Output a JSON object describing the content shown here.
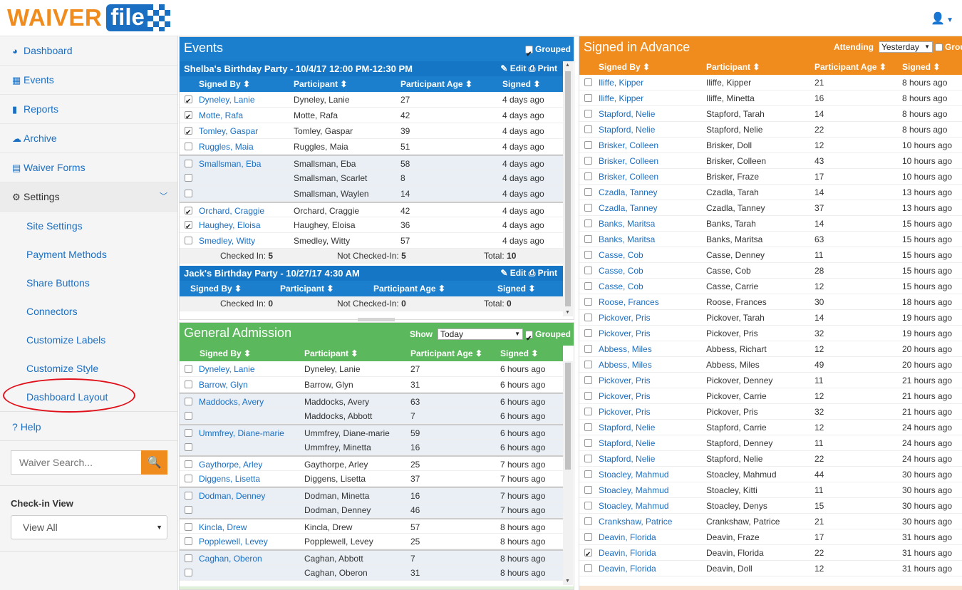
{
  "brand": {
    "waiver": "WAIVER",
    "file": "file"
  },
  "sidebar": {
    "nav": [
      {
        "icon": "◕",
        "label": "Dashboard"
      },
      {
        "icon": "▦",
        "label": "Events"
      },
      {
        "icon": "▮",
        "label": "Reports"
      },
      {
        "icon": "☁",
        "label": "Archive"
      },
      {
        "icon": "▤",
        "label": "Waiver Forms"
      }
    ],
    "settings": {
      "icon": "⚙",
      "label": "Settings"
    },
    "sub": [
      "Site Settings",
      "Payment Methods",
      "Share Buttons",
      "Connectors",
      "Customize Labels",
      "Customize Style",
      "Dashboard Layout"
    ],
    "help": {
      "icon": "?",
      "label": "Help"
    },
    "search_placeholder": "Waiver Search...",
    "checkin_label": "Check-in View",
    "checkin_value": "View All"
  },
  "events": {
    "title": "Events",
    "grouped_label": "Grouped",
    "columns": [
      "Signed By ⬍",
      "Participant ⬍",
      "Participant Age ⬍",
      "Signed ⬍"
    ],
    "groups": [
      {
        "title": "Shelba's Birthday Party - 10/4/17 12:00 PM-12:30 PM",
        "edit": "✎ Edit",
        "print": "⎙ Print",
        "rows": [
          {
            "checked": true,
            "signed_by": "Dyneley, Lanie",
            "participant": "Dyneley, Lanie",
            "age": "27",
            "signed": "4 days ago",
            "shade": false,
            "sep": false
          },
          {
            "checked": true,
            "signed_by": "Motte, Rafa",
            "participant": "Motte, Rafa",
            "age": "42",
            "signed": "4 days ago",
            "shade": false,
            "sep": false
          },
          {
            "checked": true,
            "signed_by": "Tomley, Gaspar",
            "participant": "Tomley, Gaspar",
            "age": "39",
            "signed": "4 days ago",
            "shade": false,
            "sep": false
          },
          {
            "checked": false,
            "signed_by": "Ruggles, Maia",
            "participant": "Ruggles, Maia",
            "age": "51",
            "signed": "4 days ago",
            "shade": false,
            "sep": false
          },
          {
            "checked": false,
            "signed_by": "Smallsman, Eba",
            "participant": "Smallsman, Eba",
            "age": "58",
            "signed": "4 days ago",
            "shade": true,
            "sep": true
          },
          {
            "checked": false,
            "signed_by": "",
            "participant": "Smallsman, Scarlet",
            "age": "8",
            "signed": "4 days ago",
            "shade": true,
            "sep": false
          },
          {
            "checked": false,
            "signed_by": "",
            "participant": "Smallsman, Waylen",
            "age": "14",
            "signed": "4 days ago",
            "shade": true,
            "sep": false
          },
          {
            "checked": true,
            "signed_by": "Orchard, Craggie",
            "participant": "Orchard, Craggie",
            "age": "42",
            "signed": "4 days ago",
            "shade": false,
            "sep": true
          },
          {
            "checked": true,
            "signed_by": "Haughey, Eloisa",
            "participant": "Haughey, Eloisa",
            "age": "36",
            "signed": "4 days ago",
            "shade": false,
            "sep": false
          },
          {
            "checked": false,
            "signed_by": "Smedley, Witty",
            "participant": "Smedley, Witty",
            "age": "57",
            "signed": "4 days ago",
            "shade": false,
            "sep": false
          }
        ],
        "totals": {
          "checked_label": "Checked In:",
          "checked": "5",
          "not_label": "Not Checked-In:",
          "not": "5",
          "total_label": "Total:",
          "total": "10"
        }
      },
      {
        "title": "Jack's Birthday Party - 10/27/17 4:30 AM",
        "edit": "✎ Edit",
        "print": "⎙ Print",
        "rows": [],
        "totals": {
          "checked_label": "Checked In:",
          "checked": "0",
          "not_label": "Not Checked-In:",
          "not": "0",
          "total_label": "Total:",
          "total": "0"
        }
      }
    ]
  },
  "general": {
    "title": "General Admission",
    "show_label": "Show",
    "show_value": "Today",
    "grouped_label": "Grouped",
    "columns": [
      "Signed By ⬍",
      "Participant ⬍",
      "Participant Age ⬍",
      "Signed ⬍"
    ],
    "rows": [
      {
        "checked": false,
        "signed_by": "Dyneley, Lanie",
        "participant": "Dyneley, Lanie",
        "age": "27",
        "signed": "6 hours ago",
        "shade": false,
        "sep": false
      },
      {
        "checked": false,
        "signed_by": "Barrow, Glyn",
        "participant": "Barrow, Glyn",
        "age": "31",
        "signed": "6 hours ago",
        "shade": false,
        "sep": false
      },
      {
        "checked": false,
        "signed_by": "Maddocks, Avery",
        "participant": "Maddocks, Avery",
        "age": "63",
        "signed": "6 hours ago",
        "shade": true,
        "sep": true
      },
      {
        "checked": false,
        "signed_by": "",
        "participant": "Maddocks, Abbott",
        "age": "7",
        "signed": "6 hours ago",
        "shade": true,
        "sep": false
      },
      {
        "checked": false,
        "signed_by": "Ummfrey, Diane-marie",
        "participant": "Ummfrey, Diane-marie",
        "age": "59",
        "signed": "6 hours ago",
        "shade": true,
        "sep": true
      },
      {
        "checked": false,
        "signed_by": "",
        "participant": "Ummfrey, Minetta",
        "age": "16",
        "signed": "6 hours ago",
        "shade": true,
        "sep": false
      },
      {
        "checked": false,
        "signed_by": "Gaythorpe, Arley",
        "participant": "Gaythorpe, Arley",
        "age": "25",
        "signed": "7 hours ago",
        "shade": false,
        "sep": true
      },
      {
        "checked": false,
        "signed_by": "Diggens, Lisetta",
        "participant": "Diggens, Lisetta",
        "age": "37",
        "signed": "7 hours ago",
        "shade": false,
        "sep": false
      },
      {
        "checked": false,
        "signed_by": "Dodman, Denney",
        "participant": "Dodman, Minetta",
        "age": "16",
        "signed": "7 hours ago",
        "shade": true,
        "sep": true
      },
      {
        "checked": false,
        "signed_by": "",
        "participant": "Dodman, Denney",
        "age": "46",
        "signed": "7 hours ago",
        "shade": true,
        "sep": false
      },
      {
        "checked": false,
        "signed_by": "Kincla, Drew",
        "participant": "Kincla, Drew",
        "age": "57",
        "signed": "8 hours ago",
        "shade": false,
        "sep": true
      },
      {
        "checked": false,
        "signed_by": "Popplewell, Levey",
        "participant": "Popplewell, Levey",
        "age": "25",
        "signed": "8 hours ago",
        "shade": false,
        "sep": false
      },
      {
        "checked": false,
        "signed_by": "Caghan, Oberon",
        "participant": "Caghan, Abbott",
        "age": "7",
        "signed": "8 hours ago",
        "shade": true,
        "sep": true
      },
      {
        "checked": false,
        "signed_by": "",
        "participant": "Caghan, Oberon",
        "age": "31",
        "signed": "8 hours ago",
        "shade": true,
        "sep": false
      }
    ]
  },
  "advance": {
    "title": "Signed in Advance",
    "attending_label": "Attending",
    "attending_value": "Yesterday",
    "grouped_label": "Group",
    "columns": [
      "Signed By ⬍",
      "Participant ⬍",
      "Participant Age ⬍",
      "Signed ⬍"
    ],
    "rows": [
      {
        "checked": false,
        "signed_by": "Iliffe, Kipper",
        "participant": "Iliffe, Kipper",
        "age": "21",
        "signed": "8 hours ago"
      },
      {
        "checked": false,
        "signed_by": "Iliffe, Kipper",
        "participant": "Iliffe, Minetta",
        "age": "16",
        "signed": "8 hours ago"
      },
      {
        "checked": false,
        "signed_by": "Stapford, Nelie",
        "participant": "Stapford, Tarah",
        "age": "14",
        "signed": "8 hours ago"
      },
      {
        "checked": false,
        "signed_by": "Stapford, Nelie",
        "participant": "Stapford, Nelie",
        "age": "22",
        "signed": "8 hours ago"
      },
      {
        "checked": false,
        "signed_by": "Brisker, Colleen",
        "participant": "Brisker, Doll",
        "age": "12",
        "signed": "10 hours ago"
      },
      {
        "checked": false,
        "signed_by": "Brisker, Colleen",
        "participant": "Brisker, Colleen",
        "age": "43",
        "signed": "10 hours ago"
      },
      {
        "checked": false,
        "signed_by": "Brisker, Colleen",
        "participant": "Brisker, Fraze",
        "age": "17",
        "signed": "10 hours ago"
      },
      {
        "checked": false,
        "signed_by": "Czadla, Tanney",
        "participant": "Czadla, Tarah",
        "age": "14",
        "signed": "13 hours ago"
      },
      {
        "checked": false,
        "signed_by": "Czadla, Tanney",
        "participant": "Czadla, Tanney",
        "age": "37",
        "signed": "13 hours ago"
      },
      {
        "checked": false,
        "signed_by": "Banks, Maritsa",
        "participant": "Banks, Tarah",
        "age": "14",
        "signed": "15 hours ago"
      },
      {
        "checked": false,
        "signed_by": "Banks, Maritsa",
        "participant": "Banks, Maritsa",
        "age": "63",
        "signed": "15 hours ago"
      },
      {
        "checked": false,
        "signed_by": "Casse, Cob",
        "participant": "Casse, Denney",
        "age": "11",
        "signed": "15 hours ago"
      },
      {
        "checked": false,
        "signed_by": "Casse, Cob",
        "participant": "Casse, Cob",
        "age": "28",
        "signed": "15 hours ago"
      },
      {
        "checked": false,
        "signed_by": "Casse, Cob",
        "participant": "Casse, Carrie",
        "age": "12",
        "signed": "15 hours ago"
      },
      {
        "checked": false,
        "signed_by": "Roose, Frances",
        "participant": "Roose, Frances",
        "age": "30",
        "signed": "18 hours ago"
      },
      {
        "checked": false,
        "signed_by": "Pickover, Pris",
        "participant": "Pickover, Tarah",
        "age": "14",
        "signed": "19 hours ago"
      },
      {
        "checked": false,
        "signed_by": "Pickover, Pris",
        "participant": "Pickover, Pris",
        "age": "32",
        "signed": "19 hours ago"
      },
      {
        "checked": false,
        "signed_by": "Abbess, Miles",
        "participant": "Abbess, Richart",
        "age": "12",
        "signed": "20 hours ago"
      },
      {
        "checked": false,
        "signed_by": "Abbess, Miles",
        "participant": "Abbess, Miles",
        "age": "49",
        "signed": "20 hours ago"
      },
      {
        "checked": false,
        "signed_by": "Pickover, Pris",
        "participant": "Pickover, Denney",
        "age": "11",
        "signed": "21 hours ago"
      },
      {
        "checked": false,
        "signed_by": "Pickover, Pris",
        "participant": "Pickover, Carrie",
        "age": "12",
        "signed": "21 hours ago"
      },
      {
        "checked": false,
        "signed_by": "Pickover, Pris",
        "participant": "Pickover, Pris",
        "age": "32",
        "signed": "21 hours ago"
      },
      {
        "checked": false,
        "signed_by": "Stapford, Nelie",
        "participant": "Stapford, Carrie",
        "age": "12",
        "signed": "24 hours ago"
      },
      {
        "checked": false,
        "signed_by": "Stapford, Nelie",
        "participant": "Stapford, Denney",
        "age": "11",
        "signed": "24 hours ago"
      },
      {
        "checked": false,
        "signed_by": "Stapford, Nelie",
        "participant": "Stapford, Nelie",
        "age": "22",
        "signed": "24 hours ago"
      },
      {
        "checked": false,
        "signed_by": "Stoacley, Mahmud",
        "participant": "Stoacley, Mahmud",
        "age": "44",
        "signed": "30 hours ago"
      },
      {
        "checked": false,
        "signed_by": "Stoacley, Mahmud",
        "participant": "Stoacley, Kitti",
        "age": "11",
        "signed": "30 hours ago"
      },
      {
        "checked": false,
        "signed_by": "Stoacley, Mahmud",
        "participant": "Stoacley, Denys",
        "age": "15",
        "signed": "30 hours ago"
      },
      {
        "checked": false,
        "signed_by": "Crankshaw, Patrice",
        "participant": "Crankshaw, Patrice",
        "age": "21",
        "signed": "30 hours ago"
      },
      {
        "checked": false,
        "signed_by": "Deavin, Florida",
        "participant": "Deavin, Fraze",
        "age": "17",
        "signed": "31 hours ago"
      },
      {
        "checked": true,
        "signed_by": "Deavin, Florida",
        "participant": "Deavin, Florida",
        "age": "22",
        "signed": "31 hours ago"
      },
      {
        "checked": false,
        "signed_by": "Deavin, Florida",
        "participant": "Deavin, Doll",
        "age": "12",
        "signed": "31 hours ago"
      }
    ]
  }
}
